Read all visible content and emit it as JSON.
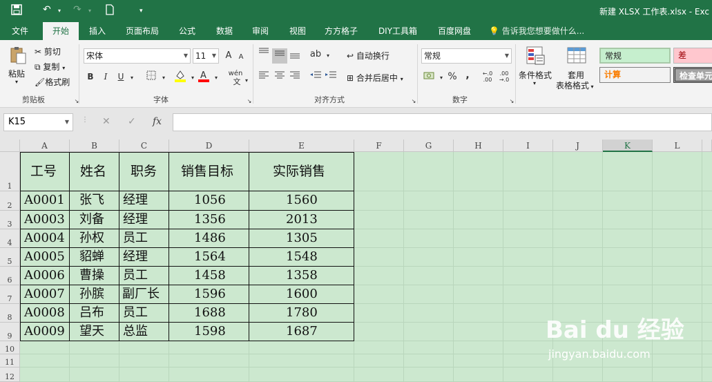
{
  "app": {
    "title": "新建 XLSX 工作表.xlsx - Exc",
    "quick_access": [
      "save-icon",
      "undo-icon",
      "redo-icon",
      "new-doc-icon",
      "customize-icon"
    ]
  },
  "menu": {
    "tabs": [
      "文件",
      "开始",
      "插入",
      "页面布局",
      "公式",
      "数据",
      "审阅",
      "视图",
      "方方格子",
      "DIY工具箱",
      "百度网盘"
    ],
    "active_tab": "开始",
    "tell_me": "告诉我您想要做什么..."
  },
  "ribbon": {
    "clipboard": {
      "paste": "粘贴",
      "cut": "剪切",
      "copy": "复制",
      "format_painter": "格式刷",
      "label": "剪贴板"
    },
    "font": {
      "name": "宋体",
      "size": "11",
      "bold": "B",
      "italic": "I",
      "underline": "U",
      "label": "字体",
      "grow": "A",
      "shrink": "A",
      "wen": "wén"
    },
    "alignment": {
      "wrap": "自动换行",
      "merge": "合并后居中",
      "label": "对齐方式"
    },
    "number": {
      "format": "常规",
      "percent": "%",
      "comma": ",",
      "label": "数字"
    },
    "styles": {
      "cond": "条件格式",
      "table1": "套用",
      "table2": "表格格式",
      "normal": "常规",
      "bad": "差",
      "calc": "计算",
      "check": "检查单元"
    }
  },
  "formula_bar": {
    "name_box": "K15",
    "cancel": "✕",
    "enter": "✓",
    "fx": "fx",
    "value": ""
  },
  "sheet": {
    "columns": [
      "A",
      "B",
      "C",
      "D",
      "E",
      "F",
      "G",
      "H",
      "I",
      "J",
      "K",
      "L"
    ],
    "selected_column": "K",
    "rows": [
      "1",
      "2",
      "3",
      "4",
      "5",
      "6",
      "7",
      "8",
      "9",
      "10",
      "11",
      "12"
    ],
    "headers": [
      "工号",
      "姓名",
      "职务",
      "销售目标",
      "实际销售"
    ],
    "data": [
      [
        "A0001",
        "张飞",
        "经理",
        "1056",
        "1560"
      ],
      [
        "A0003",
        "刘备",
        "经理",
        "1356",
        "2013"
      ],
      [
        "A0004",
        "孙权",
        "员工",
        "1486",
        "1305"
      ],
      [
        "A0005",
        "貂蝉",
        "经理",
        "1564",
        "1548"
      ],
      [
        "A0006",
        "曹操",
        "员工",
        "1458",
        "1358"
      ],
      [
        "A0007",
        "孙膑",
        "副厂长",
        "1596",
        "1600"
      ],
      [
        "A0008",
        "吕布",
        "员工",
        "1688",
        "1780"
      ],
      [
        "A0009",
        "望天",
        "总监",
        "1598",
        "1687"
      ]
    ]
  },
  "watermark": {
    "brand": "Bai du 经验",
    "url": "jingyan.baidu.com"
  },
  "colors": {
    "excel_green": "#217346",
    "sheet_bg": "#cce8cf",
    "normal_style": "#c6efce",
    "bad_style": "#ffc7ce",
    "calc_text": "#fa7d00"
  }
}
